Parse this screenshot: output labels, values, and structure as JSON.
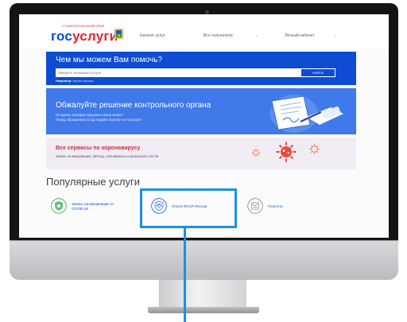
{
  "logo": {
    "small_text": "СТАВРОПОЛЬСКИЙ КРАЙ",
    "main_part1": "гос",
    "main_part2": "услуги"
  },
  "nav": {
    "catalog": "Каталог услуг",
    "recipients": "Все получатели",
    "cabinet": "Личный кабинет"
  },
  "search": {
    "title": "Чем мы можем Вам помочь?",
    "placeholder": "Введите название услуги",
    "button": "НАЙТИ",
    "hint_prefix": "Например:",
    "hint_value": "загран паспорт"
  },
  "promo": {
    "title": "Обжалуйте решение контрольного органа",
    "line1": "Во время проверки нарушены ваши права?",
    "line2": "Перед обращением в суд подайте жалобу на Госуслуги"
  },
  "covid": {
    "title": "Все сервисы по коронавирусу",
    "subtitle": "Запись на вакцинацию, QR-код, сертификаты и результаты тестов"
  },
  "popular": {
    "title": "Популярные услуги",
    "items": [
      {
        "line1": "Запись на вакцинацию от",
        "line2": "COVID-19"
      },
      {
        "line1": "Услуги ФССП России",
        "line2": ""
      },
      {
        "line1": "Госпочта",
        "line2": ""
      }
    ]
  },
  "colors": {
    "brand_blue": "#0d4cd3",
    "brand_red": "#e2262b",
    "highlight": "#1d8fe0"
  }
}
